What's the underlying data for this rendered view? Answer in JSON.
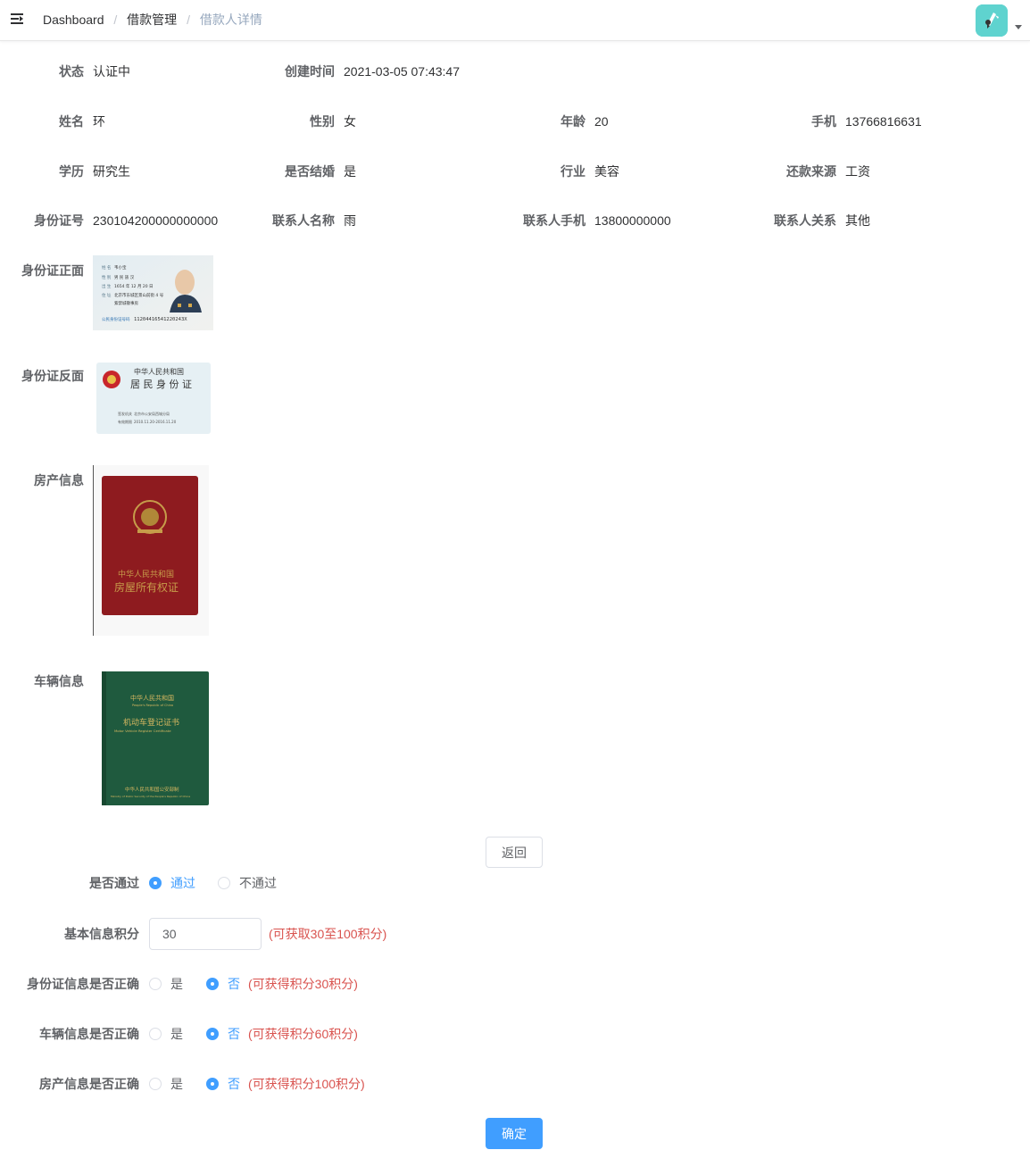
{
  "colors": {
    "primary": "#409eff",
    "hint": "#d9534f",
    "avatar_bg": "#5fd3cf"
  },
  "navbar": {
    "breadcrumb": [
      "Dashboard",
      "借款管理",
      "借款人详情"
    ],
    "icons": {
      "menu": "hamburger-icon",
      "avatar": "avatar-icon",
      "dropdown": "caret-down-icon"
    }
  },
  "detail": {
    "status_label": "状态",
    "status": "认证中",
    "created_label": "创建时间",
    "created": "2021-03-05 07:43:47",
    "name_label": "姓名",
    "name": "环",
    "gender_label": "性别",
    "gender": "女",
    "age_label": "年龄",
    "age": "20",
    "phone_label": "手机",
    "phone": "13766816631",
    "education_label": "学历",
    "education": "研究生",
    "married_label": "是否结婚",
    "married": "是",
    "industry_label": "行业",
    "industry": "美容",
    "income_label": "还款来源",
    "income": "工资",
    "idcard_label": "身份证号",
    "idcard": "230104200000000000",
    "contact_name_label": "联系人名称",
    "contact_name": "雨",
    "contact_phone_label": "联系人手机",
    "contact_phone": "13800000000",
    "contact_rel_label": "联系人关系",
    "contact_rel": "其他",
    "id_front_label": "身份证正面",
    "id_back_label": "身份证反面",
    "house_label": "房产信息",
    "car_label": "车辆信息"
  },
  "images": {
    "id_front": {
      "fields": [
        "姓 名",
        "性 别",
        "出 生",
        "住 址"
      ],
      "values": [
        "韦小宝",
        "男  民 族 汉",
        "1654 年 12 月 20 日",
        "北京市东城区景山前街 4 号"
      ],
      "address2": "紫禁城敬事房",
      "number_label": "公民身份证号码",
      "number": "11204416541220243X"
    },
    "id_back": {
      "line1": "中华人民共和国",
      "line2": "居 民 身 份 证",
      "issue_label": "签发机关",
      "issue": "北京市公安局西城分局",
      "valid_label": "有效期限",
      "valid": "2010.11.20-2016.11.20"
    },
    "house": {
      "line1": "中华人民共和国",
      "line2": "房屋所有权证"
    },
    "car": {
      "line1": "中华人民共和国",
      "line1_en": "People's Republic of China",
      "line2": "机动车登记证书",
      "line2_en": "Motor Vehicle Register Certificate",
      "footer": "中华人民共和国公安部制",
      "footer_en": "Ministry of Public Security of the People's Republic of China"
    }
  },
  "actions": {
    "back": "返回",
    "confirm": "确定"
  },
  "review": {
    "pass_label": "是否通过",
    "pass_yes": "通过",
    "pass_no": "不通过",
    "pass_selected": "通过",
    "basic_score_label": "基本信息积分",
    "basic_score": "30",
    "basic_hint": "(可获取30至100积分)",
    "id_ok_label": "身份证信息是否正确",
    "id_yes": "是",
    "id_no": "否",
    "id_selected": "否",
    "id_hint": "(可获得积分30积分)",
    "car_ok_label": "车辆信息是否正确",
    "car_yes": "是",
    "car_no": "否",
    "car_selected": "否",
    "car_hint": "(可获得积分60积分)",
    "house_ok_label": "房产信息是否正确",
    "house_yes": "是",
    "house_no": "否",
    "house_selected": "否",
    "house_hint": "(可获得积分100积分)"
  }
}
